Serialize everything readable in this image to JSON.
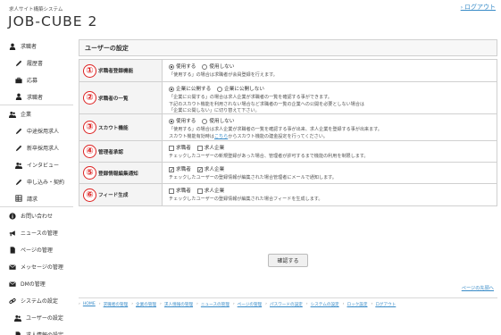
{
  "header": {
    "system_name": "求人サイト構築システム",
    "logo": "JOB-CUBE 2",
    "logout": "ログアウト"
  },
  "sidebar": {
    "items": [
      {
        "label": "求職者",
        "icon": "person-icon",
        "level": "top"
      },
      {
        "label": "履歴書",
        "icon": "pencil-icon",
        "level": "sub"
      },
      {
        "label": "応募",
        "icon": "briefcase-icon",
        "level": "sub"
      },
      {
        "label": "求職者",
        "icon": "person-icon",
        "level": "sub"
      },
      {
        "label": "企業",
        "icon": "people-icon",
        "level": "top"
      },
      {
        "label": "中途採用求人",
        "icon": "pencil-icon",
        "level": "sub"
      },
      {
        "label": "新卒採用求人",
        "icon": "pencil-icon",
        "level": "sub"
      },
      {
        "label": "インタビュー",
        "icon": "people-icon",
        "level": "sub"
      },
      {
        "label": "申し込み・契約",
        "icon": "pencil-icon",
        "level": "sub"
      },
      {
        "label": "請求",
        "icon": "table-icon",
        "level": "sub"
      },
      {
        "label": "お問い合わせ",
        "icon": "info-icon",
        "level": "top"
      },
      {
        "label": "ニュースの管理",
        "icon": "bullhorn-icon",
        "level": "top"
      },
      {
        "label": "ページの管理",
        "icon": "file-icon",
        "level": "top"
      },
      {
        "label": "メッセージの管理",
        "icon": "envelope-icon",
        "level": "top"
      },
      {
        "label": "DMの管理",
        "icon": "envelope-icon",
        "level": "top"
      },
      {
        "label": "システムの設定",
        "icon": "link-icon",
        "level": "top"
      },
      {
        "label": "ユーザーの設定",
        "icon": "people-icon",
        "level": "sub2"
      },
      {
        "label": "求人情報の設定",
        "icon": "file-icon",
        "level": "sub2"
      }
    ]
  },
  "main": {
    "title": "ユーザーの設定",
    "settings": [
      {
        "number": "①",
        "label": "求職者登録機能",
        "options": [
          {
            "label": "使用する",
            "checked": true
          },
          {
            "label": "使用しない",
            "checked": false
          }
        ],
        "type": "radio",
        "desc": [
          "「使用する」の場合は求職者が会員登録を行えます。"
        ]
      },
      {
        "number": "②",
        "label": "求職者の一覧",
        "options": [
          {
            "label": "企業に公開する",
            "checked": true
          },
          {
            "label": "企業に公開しない",
            "checked": false
          }
        ],
        "type": "radio",
        "desc": [
          "「企業に公開する」の場合は求人企業が求職者の一覧を確認する事ができます。",
          "下記のスカウト機能を利用されない場合など求職者の一覧の企業への公開を必要としない場合は",
          "「企業に公開しない」に切り替えて下さい。"
        ]
      },
      {
        "number": "③",
        "label": "スカウト機能",
        "options": [
          {
            "label": "使用する",
            "checked": true
          },
          {
            "label": "使用しない",
            "checked": false
          }
        ],
        "type": "radio",
        "desc_pre": "「使用する」の場合は求人企業が求職者の一覧を確認する事が出来、求人企業を登録する事が出来ます。",
        "desc_line2_pre": "スカウト機能有効時は",
        "desc_link": "こちら",
        "desc_line2_post": "からスカウト機能の建金設定を行ってください。"
      },
      {
        "number": "④",
        "label": "管理者承認",
        "options": [
          {
            "label": "求職者",
            "checked": false
          },
          {
            "label": "求人企業",
            "checked": false
          }
        ],
        "type": "check",
        "desc": [
          "チェックしたユーザーの新規登録があった場合、管理者が許可するまで機能の利用を制限します。"
        ]
      },
      {
        "number": "⑤",
        "label": "登録情報編集通知",
        "options": [
          {
            "label": "求職者",
            "checked": true
          },
          {
            "label": "求人企業",
            "checked": true
          }
        ],
        "type": "check",
        "desc": [
          "チェックしたユーザーの登録情報が編集された場合管理者にメールで通知します。"
        ]
      },
      {
        "number": "⑥",
        "label": "フィード生成",
        "options": [
          {
            "label": "求職者",
            "checked": false
          },
          {
            "label": "求人企業",
            "checked": false
          }
        ],
        "type": "check",
        "desc": [
          "チェックしたユーザーの登録情報が編集された場合フィードを生成します。"
        ]
      }
    ],
    "confirm": "確認する",
    "page_top": "ページの先頭へ"
  },
  "footer_nav": [
    "HOME",
    "求職者の管理",
    "企業の管理",
    "求人情報の管理",
    "ニュースの管理",
    "ページの管理",
    "パスワードの設定",
    "システムの設定",
    "ロック設定",
    "ログアウト"
  ]
}
